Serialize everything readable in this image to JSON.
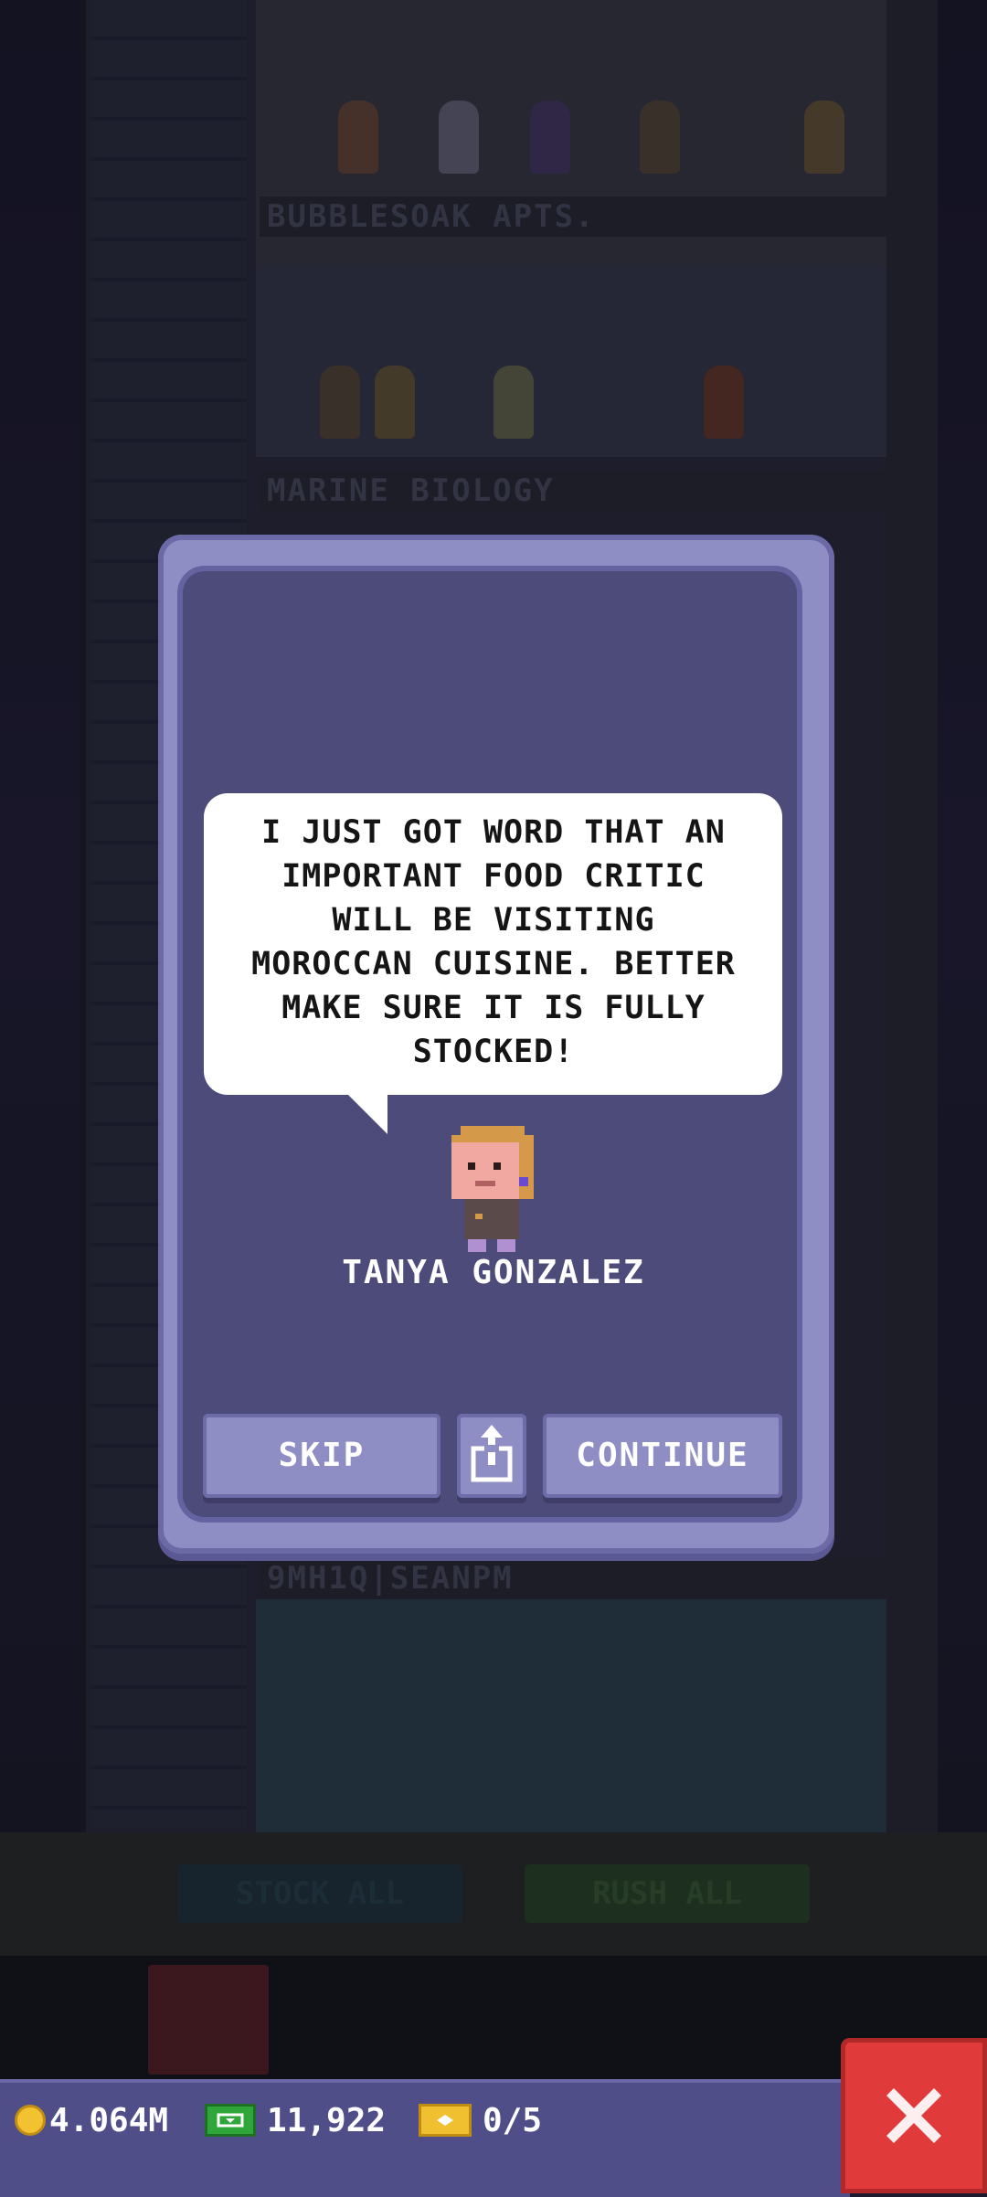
{
  "background": {
    "floors": [
      {
        "name": "BUBBLESOAK APTS."
      },
      {
        "name": "MARINE BIOLOGY"
      },
      {
        "name": "9MH1Q|SEANPM"
      }
    ],
    "toolbar": {
      "stock_all_label": "STOCK ALL",
      "rush_all_label": "RUSH ALL"
    }
  },
  "dialog": {
    "message": "I JUST GOT WORD THAT AN\nIMPORTANT FOOD CRITIC\nWILL BE VISITING\nMOROCCAN CUISINE. BETTER\nMAKE SURE IT IS FULLY\nSTOCKED!",
    "speaker": "TANYA GONZALEZ",
    "buttons": {
      "skip": "SKIP",
      "share_icon": "share-icon",
      "continue": "CONTINUE"
    }
  },
  "hud": {
    "coins": "4.064M",
    "bux": "11,922",
    "tickets": "0/5",
    "close_icon": "close-icon"
  },
  "colors": {
    "dialog_frame": "#8e8dc4",
    "dialog_inner": "#4d4b7a",
    "hud_bar": "#504e88",
    "close_button": "#e03a3a"
  }
}
